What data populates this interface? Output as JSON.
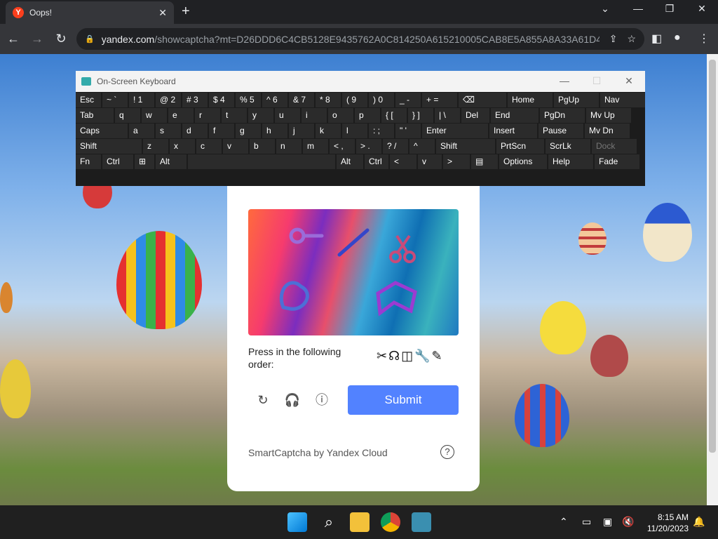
{
  "browser": {
    "tab_title": "Oops!",
    "tab_favicon": "Y",
    "url_main": "yandex.com",
    "url_rest": "/showcaptcha?mt=D26DDD6C4CB5128E9435762A0C814250A615210005CAB8E5A855A8A33A61D43..."
  },
  "osk": {
    "title": "On-Screen Keyboard",
    "rows": [
      [
        "Esc",
        "~ `",
        "! 1",
        "@ 2",
        "# 3",
        "$ 4",
        "% 5",
        "^ 6",
        "& 7",
        "* 8",
        "( 9",
        ") 0",
        "_ -",
        "+ =",
        "⌫",
        "Home",
        "PgUp",
        "Nav"
      ],
      [
        "Tab",
        "q",
        "w",
        "e",
        "r",
        "t",
        "y",
        "u",
        "i",
        "o",
        "p",
        "{ [",
        "} ]",
        "| \\",
        "Del",
        "End",
        "PgDn",
        "Mv Up"
      ],
      [
        "Caps",
        "a",
        "s",
        "d",
        "f",
        "g",
        "h",
        "j",
        "k",
        "l",
        ": ;",
        "\" '",
        "Enter",
        "Insert",
        "Pause",
        "Mv Dn"
      ],
      [
        "Shift",
        "z",
        "x",
        "c",
        "v",
        "b",
        "n",
        "m",
        "< ,",
        "> .",
        "? /",
        "^",
        "Shift",
        "PrtScn",
        "ScrLk",
        "Dock"
      ],
      [
        "Fn",
        "Ctrl",
        "⊞",
        "Alt",
        "",
        "Alt",
        "Ctrl",
        "<",
        "v",
        ">",
        "▤",
        "Options",
        "Help",
        "Fade"
      ]
    ]
  },
  "captcha": {
    "prompt": "Press in the following order:",
    "order_icons": "✂☊◫🔧✎",
    "submit_label": "Submit",
    "brand": "SmartCaptcha by Yandex Cloud",
    "help": "?"
  },
  "taskbar": {
    "time": "8:15 AM",
    "date": "11/20/2023"
  }
}
